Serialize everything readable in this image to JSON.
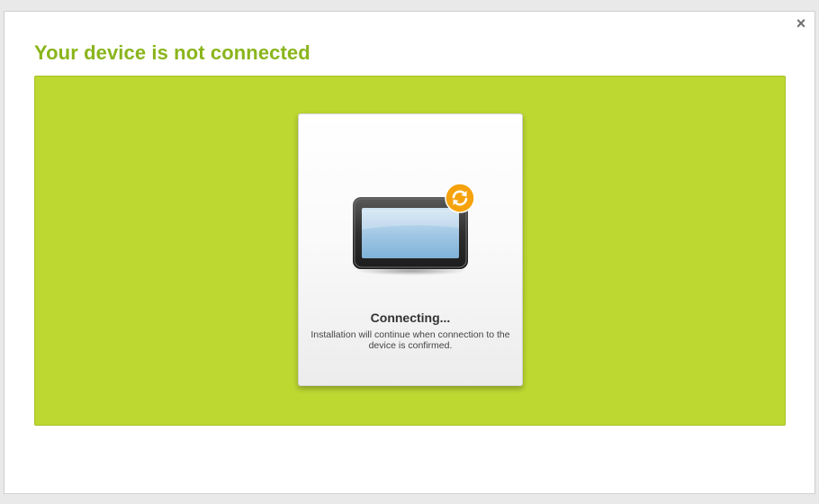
{
  "dialog": {
    "close_label": "×",
    "title": "Your device is not connected"
  },
  "status": {
    "title": "Connecting...",
    "description": "Installation will continue when connection to the device is confirmed."
  },
  "icons": {
    "close": "close-icon",
    "device": "device-icon",
    "sync": "sync-icon"
  },
  "colors": {
    "title_green": "#8ab51c",
    "panel_green": "#bcd831",
    "badge_orange": "#f5a20d"
  }
}
